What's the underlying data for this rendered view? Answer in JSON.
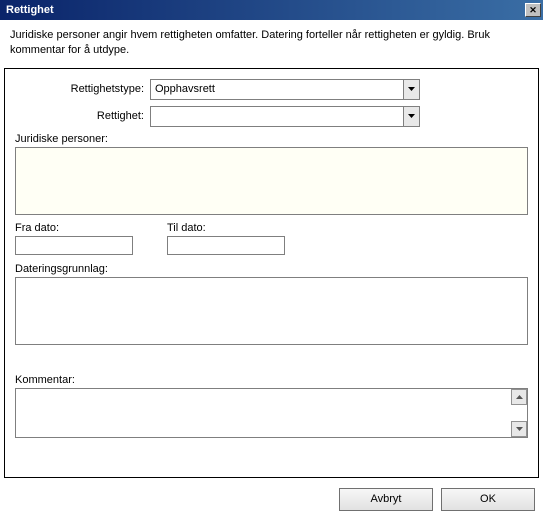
{
  "title": "Rettighet",
  "description": "Juridiske personer angir hvem rettigheten omfatter. Datering forteller når rettigheten er gyldig. Bruk kommentar for å utdype.",
  "fields": {
    "type_label": "Rettighetstype:",
    "type_value": "Opphavsrett",
    "right_label": "Rettighet:",
    "right_value": "",
    "juridiske_label": "Juridiske personer:",
    "juridiske_value": "",
    "fra_label": "Fra dato:",
    "fra_value": "",
    "til_label": "Til dato:",
    "til_value": "",
    "grunnlag_label": "Dateringsgrunnlag:",
    "grunnlag_value": "",
    "kommentar_label": "Kommentar:",
    "kommentar_value": ""
  },
  "buttons": {
    "cancel": "Avbryt",
    "ok": "OK"
  }
}
